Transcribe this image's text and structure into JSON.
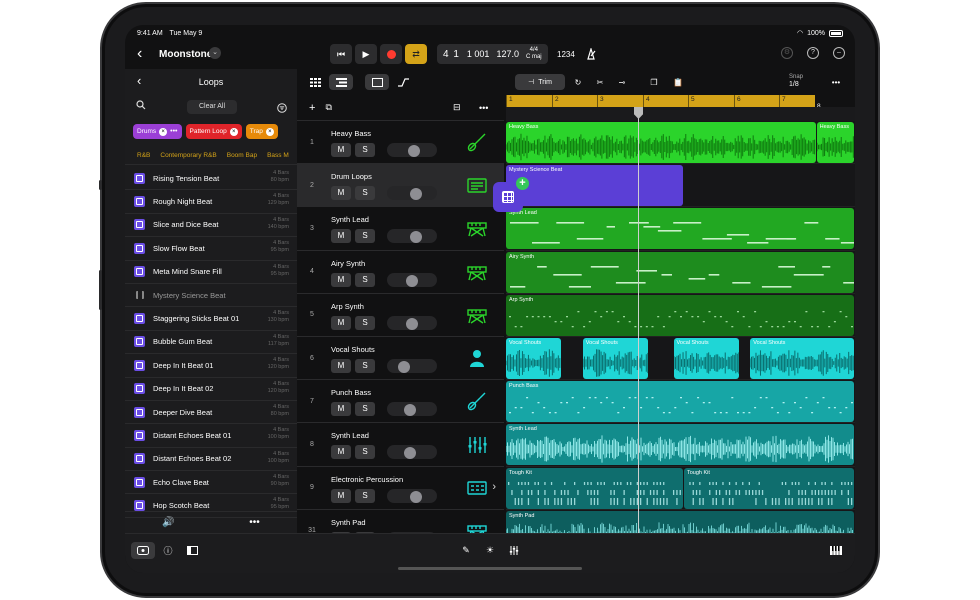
{
  "status": {
    "time": "9:41 AM",
    "date": "Tue May 9",
    "battery": "100%"
  },
  "project": {
    "name": "Moonstone"
  },
  "lcd": {
    "position": "4 1",
    "ticks": "1 001",
    "tempo": "127.0",
    "time_sig": "4/4",
    "key": "C maj"
  },
  "count_in": "1234",
  "browser": {
    "title": "Loops",
    "clear_all": "Clear All",
    "tags": [
      {
        "label": "Drums",
        "color": "#9b3fd6"
      },
      {
        "label": "Pattern Loop",
        "color": "#e0242a"
      },
      {
        "label": "Trap",
        "color": "#e68a0a"
      }
    ],
    "subtags": [
      "R&B",
      "Contemporary R&B",
      "Boom Bap",
      "Bass M"
    ],
    "loops": [
      {
        "name": "Rising Tension Beat",
        "meta1": "4 Bars",
        "meta2": "80 bpm"
      },
      {
        "name": "Rough Night Beat",
        "meta1": "4 Bars",
        "meta2": "129 bpm"
      },
      {
        "name": "Slice and Dice Beat",
        "meta1": "4 Bars",
        "meta2": "140 bpm"
      },
      {
        "name": "Slow Flow Beat",
        "meta1": "4 Bars",
        "meta2": "95 bpm"
      },
      {
        "name": "Meta Mind Snare Fill",
        "meta1": "4 Bars",
        "meta2": "95 bpm"
      },
      {
        "name": "Mystery Science Beat",
        "meta1": "",
        "meta2": "",
        "dragging": true
      },
      {
        "name": "Staggering Sticks Beat 01",
        "meta1": "4 Bars",
        "meta2": "130 bpm"
      },
      {
        "name": "Bubble Gum Beat",
        "meta1": "4 Bars",
        "meta2": "117 bpm"
      },
      {
        "name": "Deep In It Beat 01",
        "meta1": "4 Bars",
        "meta2": "120 bpm"
      },
      {
        "name": "Deep In It Beat 02",
        "meta1": "4 Bars",
        "meta2": "120 bpm"
      },
      {
        "name": "Deeper Dive Beat",
        "meta1": "4 Bars",
        "meta2": "80 bpm"
      },
      {
        "name": "Distant Echoes Beat 01",
        "meta1": "4 Bars",
        "meta2": "100 bpm"
      },
      {
        "name": "Distant Echoes Beat 02",
        "meta1": "4 Bars",
        "meta2": "100 bpm"
      },
      {
        "name": "Echo Clave Beat",
        "meta1": "4 Bars",
        "meta2": "90 bpm"
      },
      {
        "name": "Hop Scotch Beat",
        "meta1": "4 Bars",
        "meta2": "95 bpm"
      }
    ]
  },
  "snap": {
    "label": "Snap",
    "value": "1/8"
  },
  "trim_label": "Trim",
  "tracks": [
    {
      "num": "1",
      "name": "Heavy Bass",
      "mute": "M",
      "solo": "S",
      "icon": "bass-guitar-icon",
      "color": "#2bd42b",
      "volume": 0.55
    },
    {
      "num": "2",
      "name": "Drum Loops",
      "mute": "M",
      "solo": "S",
      "icon": "drum-machine-icon",
      "color": "#2bd42b",
      "volume": 0.6,
      "selected": true
    },
    {
      "num": "3",
      "name": "Synth Lead",
      "mute": "M",
      "solo": "S",
      "icon": "keyboard-icon",
      "color": "#2bd42b",
      "volume": 0.6
    },
    {
      "num": "4",
      "name": "Airy Synth",
      "mute": "M",
      "solo": "S",
      "icon": "keyboard-icon",
      "color": "#2bd42b",
      "volume": 0.5
    },
    {
      "num": "5",
      "name": "Arp Synth",
      "mute": "M",
      "solo": "S",
      "icon": "keyboard-icon",
      "color": "#2bd42b",
      "volume": 0.5
    },
    {
      "num": "6",
      "name": "Vocal Shouts",
      "mute": "M",
      "solo": "S",
      "icon": "vocalist-icon",
      "color": "#1fd6d6",
      "volume": 0.3
    },
    {
      "num": "7",
      "name": "Punch Bass",
      "mute": "M",
      "solo": "S",
      "icon": "bass-guitar-icon",
      "color": "#1fd6d6",
      "volume": 0.45
    },
    {
      "num": "8",
      "name": "Synth Lead",
      "mute": "M",
      "solo": "S",
      "icon": "mixer-icon",
      "color": "#1fd6d6",
      "volume": 0.45
    },
    {
      "num": "9",
      "name": "Electronic Percussion",
      "mute": "M",
      "solo": "S",
      "icon": "beat-pad-icon",
      "color": "#1fd6d6",
      "volume": 0.6
    },
    {
      "num": "31",
      "name": "Synth Pad",
      "mute": "M",
      "solo": "S",
      "icon": "keyboard-icon",
      "color": "#1fd6d6",
      "volume": 0.5
    }
  ],
  "ruler": {
    "marks": [
      "1",
      "2",
      "3",
      "4",
      "5",
      "6",
      "7",
      "8"
    ]
  },
  "regions": [
    {
      "lane": 0,
      "label": "Heavy Bass",
      "start": 0,
      "end": 0.89,
      "color": "#2bd42b",
      "style": "wave",
      "wcolor": "#0f7a0f"
    },
    {
      "lane": 0,
      "label": "Heavy Bass",
      "start": 0.89,
      "end": 1.0,
      "color": "#2bd42b",
      "style": "wave",
      "wcolor": "#0f7a0f"
    },
    {
      "lane": 1,
      "label": "Mystery Science Beat",
      "start": 0,
      "end": 0.51,
      "color": "#5b3fd6",
      "style": "none",
      "wcolor": "#3a28a0"
    },
    {
      "lane": 2,
      "label": "Synth Lead",
      "start": 0,
      "end": 1.0,
      "color": "#22a822",
      "style": "midi",
      "wcolor": "#c8f0c8"
    },
    {
      "lane": 3,
      "label": "Airy Synth",
      "start": 0,
      "end": 1.0,
      "color": "#1e8c1e",
      "style": "midi",
      "wcolor": "#c8f0c8"
    },
    {
      "lane": 4,
      "label": "Arp Synth",
      "start": 0,
      "end": 1.0,
      "color": "#176f17",
      "style": "dots",
      "wcolor": "#9ad89a"
    },
    {
      "lane": 5,
      "label": "Vocal Shouts",
      "start": 0,
      "end": 0.16,
      "color": "#1fd6d6",
      "style": "wave",
      "wcolor": "#0a6e6e"
    },
    {
      "lane": 5,
      "label": "Vocal Shouts",
      "start": 0.22,
      "end": 0.41,
      "color": "#1fd6d6",
      "style": "wave",
      "wcolor": "#0a6e6e"
    },
    {
      "lane": 5,
      "label": "Vocal Shouts",
      "start": 0.48,
      "end": 0.67,
      "color": "#1fd6d6",
      "style": "wave",
      "wcolor": "#0a6e6e"
    },
    {
      "lane": 5,
      "label": "Vocal Shouts",
      "start": 0.7,
      "end": 1.0,
      "color": "#1fd6d6",
      "style": "wave",
      "wcolor": "#0a6e6e"
    },
    {
      "lane": 6,
      "label": "Punch Bass",
      "start": 0,
      "end": 1.0,
      "color": "#17a6a6",
      "style": "dots",
      "wcolor": "#b0f0f0"
    },
    {
      "lane": 7,
      "label": "Synth Lead",
      "start": 0,
      "end": 1.0,
      "color": "#128c8c",
      "style": "wave",
      "wcolor": "#8ee6e6"
    },
    {
      "lane": 8,
      "label": "Tough Kit",
      "start": 0,
      "end": 0.51,
      "color": "#0f6e6e",
      "style": "beats",
      "wcolor": "#9ad8d8"
    },
    {
      "lane": 8,
      "label": "Tough Kit",
      "start": 0.51,
      "end": 1.0,
      "color": "#0f6e6e",
      "style": "beats",
      "wcolor": "#9ad8d8"
    },
    {
      "lane": 9,
      "label": "Synth Pad",
      "start": 0,
      "end": 1.0,
      "color": "#0d5e5e",
      "style": "wave",
      "wcolor": "#6ccccc"
    }
  ]
}
